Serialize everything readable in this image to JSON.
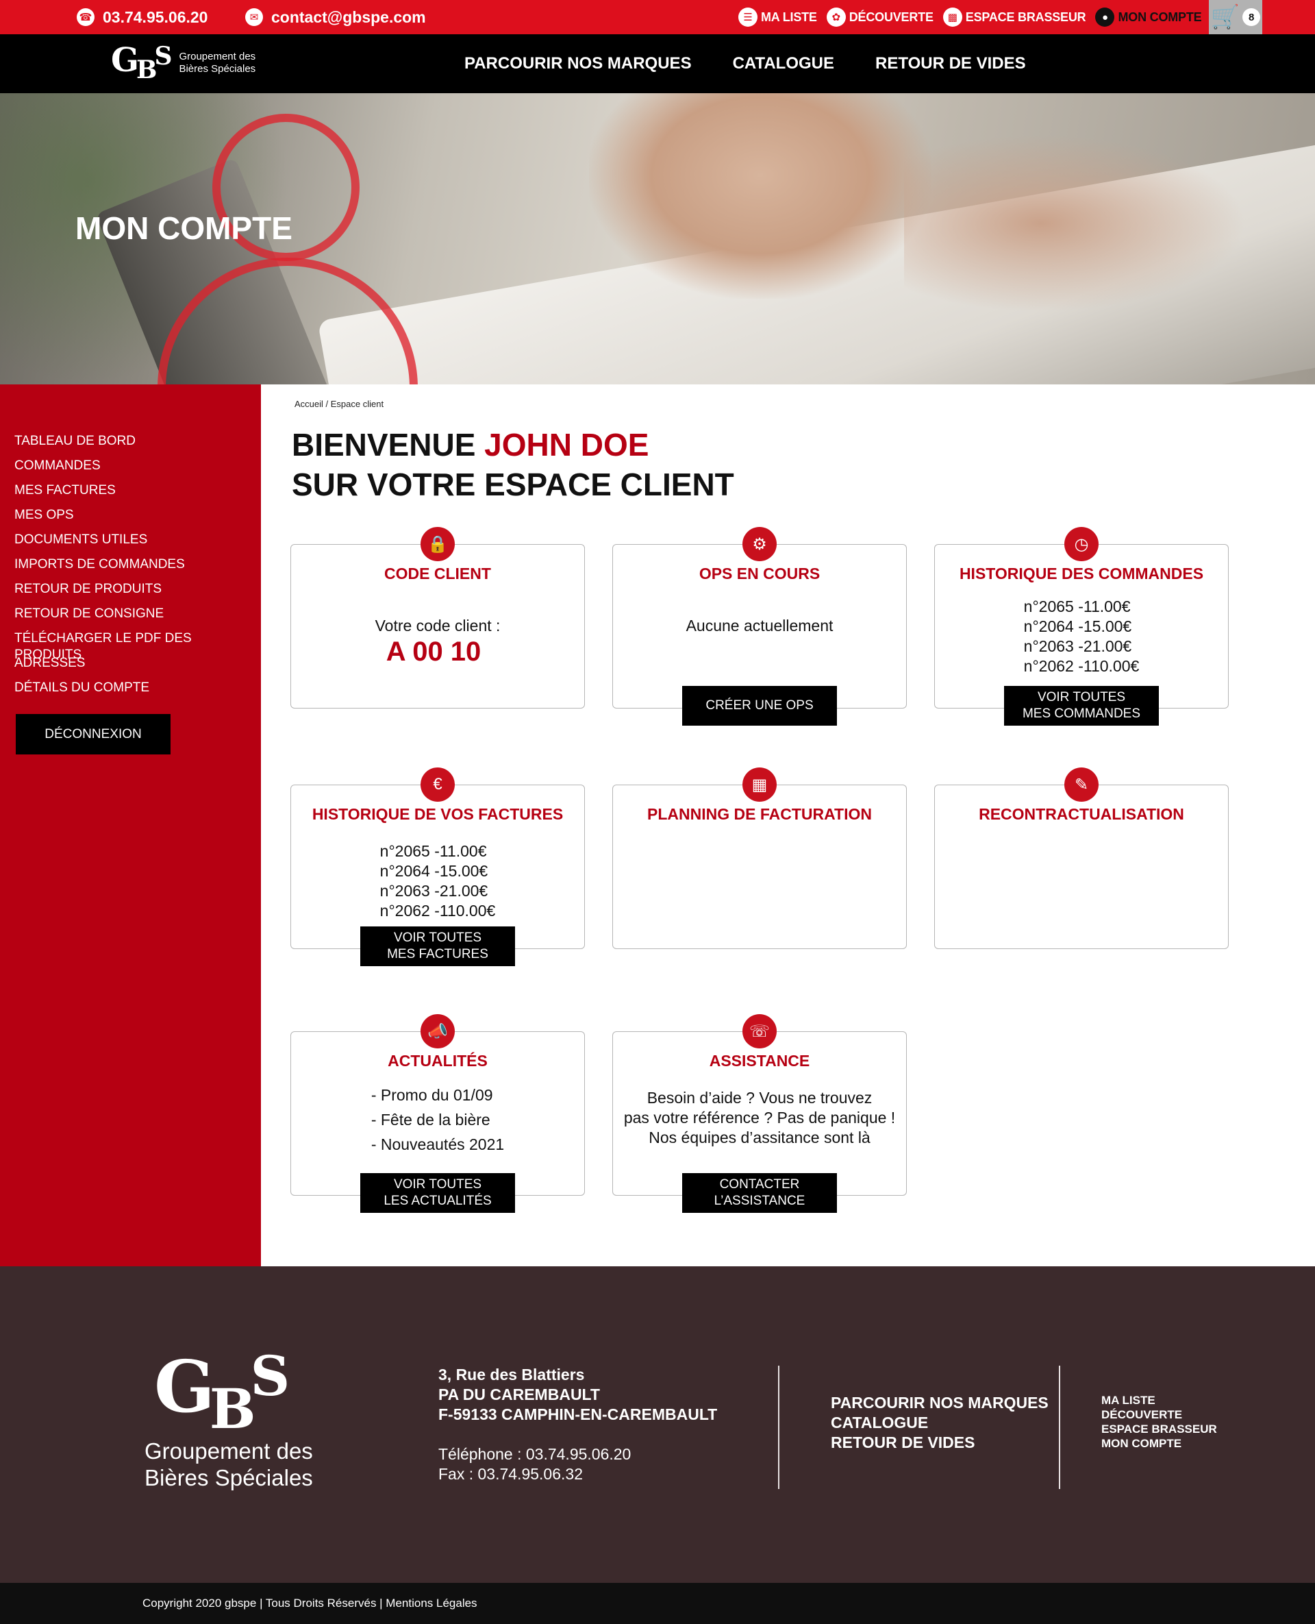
{
  "topbar": {
    "phone": "03.74.95.06.20",
    "email": "contact@gbspe.com",
    "links": [
      {
        "label": "MA LISTE",
        "icon": "list-icon"
      },
      {
        "label": "DÉCOUVERTE",
        "icon": "hops-icon"
      },
      {
        "label": "ESPACE BRASSEUR",
        "icon": "barrel-icon"
      },
      {
        "label": "MON COMPTE",
        "icon": "user-icon"
      }
    ],
    "cart_count": "8"
  },
  "logo": {
    "mark_g": "G",
    "mark_b": "B",
    "mark_s": "S",
    "line1": "Groupement des",
    "line2": "Bières Spéciales"
  },
  "nav": [
    "PARCOURIR NOS MARQUES",
    "CATALOGUE",
    "RETOUR DE VIDES"
  ],
  "hero": {
    "title": "MON COMPTE"
  },
  "sidebar": {
    "items": [
      "TABLEAU DE BORD",
      "COMMANDES",
      "MES FACTURES",
      "MES OPS",
      "DOCUMENTS UTILES",
      "IMPORTS DE COMMANDES",
      "RETOUR DE PRODUITS",
      "RETOUR DE CONSIGNE",
      "TÉLÉCHARGER LE PDF DES PRODUITS",
      "ADRESSES",
      "DÉTAILS DU COMPTE"
    ],
    "logout": "DÉCONNEXION"
  },
  "breadcrumb": "Accueil / Espace client",
  "welcome": {
    "line1_prefix": "BIENVENUE ",
    "name": "JOHN DOE",
    "line2": "SUR VOTRE ESPACE CLIENT"
  },
  "cards": {
    "code_client": {
      "title": "CODE CLIENT",
      "label": "Votre code client :",
      "value": "A 00 10"
    },
    "ops": {
      "title": "OPS EN COURS",
      "text": "Aucune actuellement",
      "button": "CRÉER UNE OPS"
    },
    "orders": {
      "title": "HISTORIQUE DES COMMANDES",
      "items": [
        "n°2065 -11.00€",
        "n°2064 -15.00€",
        "n°2063 -21.00€",
        "n°2062 -110.00€"
      ],
      "button_l1": "VOIR TOUTES",
      "button_l2": "MES COMMANDES"
    },
    "invoices": {
      "title": "HISTORIQUE DE VOS FACTURES",
      "items": [
        "n°2065 -11.00€",
        "n°2064 -15.00€",
        "n°2063 -21.00€",
        "n°2062 -110.00€"
      ],
      "button_l1": "VOIR TOUTES",
      "button_l2": "MES FACTURES"
    },
    "planning": {
      "title": "PLANNING DE FACTURATION"
    },
    "recontract": {
      "title": "RECONTRACTUALISATION"
    },
    "news": {
      "title": "ACTUALITÉS",
      "items": [
        "- Promo du 01/09",
        "- Fête de la bière",
        "- Nouveautés 2021"
      ],
      "button_l1": "VOIR TOUTES",
      "button_l2": "LES ACTUALITÉS"
    },
    "assistance": {
      "title": "ASSISTANCE",
      "lines": [
        "Besoin d’aide ? Vous ne trouvez",
        "pas votre référence ? Pas de panique !",
        "Nos équipes d’assitance sont là"
      ],
      "button_l1": "CONTACTER",
      "button_l2": "L’ASSISTANCE"
    }
  },
  "footer": {
    "tag1": "Groupement des",
    "tag2": "Bières Spéciales",
    "address": [
      "3, Rue des Blattiers",
      "PA DU CAREMBAULT",
      "F-59133 CAMPHIN-EN-CAREMBAULT"
    ],
    "phone": "Téléphone : 03.74.95.06.20",
    "fax": "Fax : 03.74.95.06.32",
    "nav": [
      "PARCOURIR NOS MARQUES",
      "CATALOGUE",
      "RETOUR DE VIDES"
    ],
    "nav2": [
      "MA LISTE",
      "DÉCOUVERTE",
      "ESPACE BRASSEUR",
      "MON COMPTE"
    ],
    "copyright": "Copyright 2020 gbspe | Tous Droits Réservés | Mentions Légales"
  },
  "colors": {
    "brand_red": "#dd0f1d",
    "sidebar_red": "#b60012",
    "footer_brown": "#3c2a2c"
  }
}
